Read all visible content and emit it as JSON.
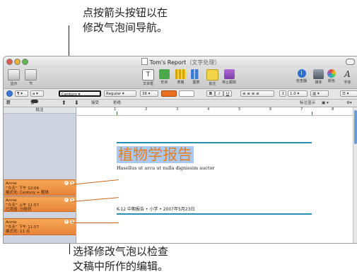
{
  "callouts": {
    "top_line1": "点按箭头按钮以在",
    "top_line2": "修改气泡间导航。",
    "bottom_line1": "选择修改气泡以检查",
    "bottom_line2": "文稿中所作的编辑。"
  },
  "window": {
    "title": "Tom's Report",
    "title_suffix": "（文字处理）"
  },
  "toolbar": {
    "display_label": "显示",
    "section_label": "节",
    "textbox_label": "文本框",
    "shape_label": "形状",
    "table_label": "表格",
    "chart_label": "图表",
    "comment_label": "批注",
    "stop_tracking_label": "停止跟踪",
    "inspector_label": "检查器",
    "media_label": "媒体",
    "colors_label": "颜色",
    "fonts_label": "字体"
  },
  "formatbar": {
    "para_style": "¶",
    "char_style": "a",
    "font_family": "Century",
    "font_weight": "Regular",
    "font_size": "36",
    "bold": "B",
    "italic": "I",
    "underline": "U",
    "line_spacing": "1.0"
  },
  "tracking_bar": {
    "tracking_label": "跟踪：",
    "on_label": "打开",
    "paused_label": "暂停",
    "accept_label": "接受",
    "reject_label": "拒绝",
    "markup_label": "标注显示"
  },
  "comments_pane": {
    "header": "批注",
    "bubbles": [
      {
        "author": "Annie",
        "date_line": "“今天” 下午 12:04",
        "change": "格式化: Century + 粗体"
      },
      {
        "author": "Annie",
        "date_line": "“今天” 上午 11:57",
        "change": "已添加: 分段符"
      },
      {
        "author": "Annie",
        "date_line": "“今天” 下午 11:57",
        "change": "格式化: 11 点"
      }
    ]
  },
  "ruler": {
    "labels": [
      "1",
      "2",
      "3",
      "4",
      "5",
      "6",
      "7",
      "8"
    ]
  },
  "document": {
    "title": "植物学报告",
    "subtitle": "Hasellus ut arcu ut nulla dignissim auctor",
    "footer": "K-12 中期报告 • 小学 • 2007年5月23日"
  },
  "colors": {
    "accent_blue": "#2a8eb3",
    "bubble_orange": "#f09a4a",
    "title_orange": "#e67e22",
    "selection_blue": "#a9c9f0"
  }
}
